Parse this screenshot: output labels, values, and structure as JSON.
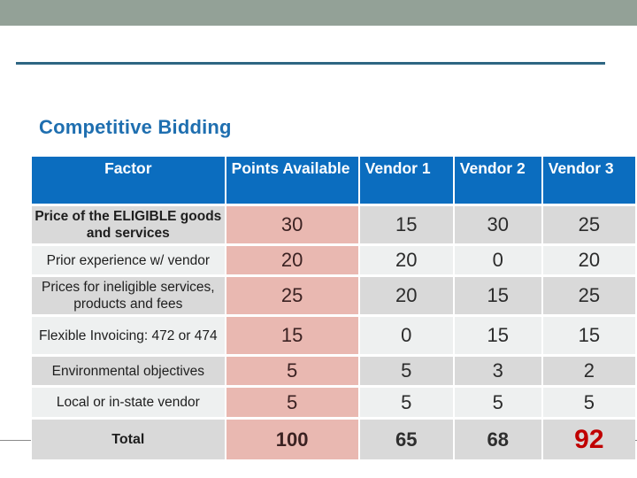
{
  "slide": {
    "heading": "Competitive Bidding",
    "accent_color": "#0b6dbf",
    "winner_color": "#c00000"
  },
  "table": {
    "headers": [
      "Factor",
      "Points Available",
      "Vendor 1",
      "Vendor 2",
      "Vendor 3"
    ],
    "rows": [
      {
        "factor": "Price of the ELIGIBLE goods and services",
        "points": "30",
        "v1": "15",
        "v2": "30",
        "v3": "25"
      },
      {
        "factor": "Prior experience w/ vendor",
        "points": "20",
        "v1": "20",
        "v2": "0",
        "v3": "20"
      },
      {
        "factor": "Prices for ineligible services, products and fees",
        "points": "25",
        "v1": "20",
        "v2": "15",
        "v3": "25"
      },
      {
        "factor": "Flexible Invoicing: 472 or 474",
        "points": "15",
        "v1": "0",
        "v2": "15",
        "v3": "15"
      },
      {
        "factor": "Environmental objectives",
        "points": "5",
        "v1": "5",
        "v2": "3",
        "v3": "2"
      },
      {
        "factor": "Local or in-state vendor",
        "points": "5",
        "v1": "5",
        "v2": "5",
        "v3": "5"
      }
    ],
    "total": {
      "label": "Total",
      "points": "100",
      "v1": "65",
      "v2": "68",
      "v3": "92"
    }
  }
}
